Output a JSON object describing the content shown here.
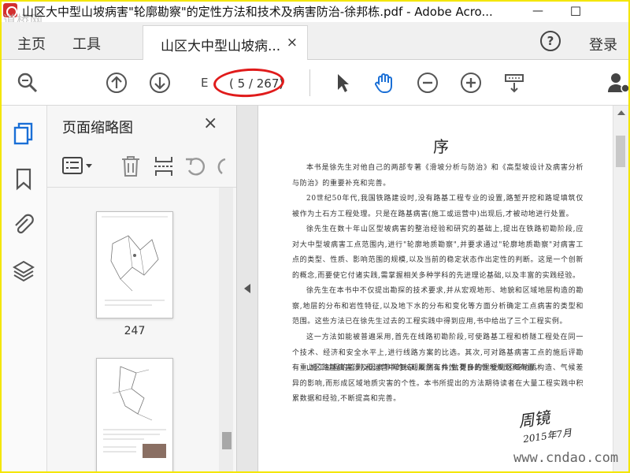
{
  "window": {
    "title": "山区大中型山坡病害\"轮廓勘察\"的定性方法和技术及病害防治-徐邦栋.pdf - Adobe Acro...",
    "minimize_glyph": "—",
    "maximize_glyph": "☐",
    "watermark": "道桥网"
  },
  "tabs": {
    "home": "主页",
    "tools": "工具",
    "document": "山区大中型山坡病...",
    "close_glyph": "×",
    "help_glyph": "?",
    "login": "登录"
  },
  "toolbar": {
    "page_input_value": "E",
    "page_indicator": "( 5 / 267)",
    "icons": [
      "zoom-icon",
      "prev-page-icon",
      "next-page-icon",
      "select-cursor-icon",
      "hand-tool-icon",
      "zoom-out-icon",
      "zoom-in-icon",
      "fit-page-icon",
      "share-user-icon"
    ]
  },
  "left_rail": {
    "icons": [
      "page-thumbnails-icon",
      "bookmark-icon",
      "attachment-icon",
      "layers-icon"
    ]
  },
  "thumbnail_panel": {
    "title": "页面缩略图",
    "close_glyph": "×",
    "tools": [
      "thumbnail-options-icon",
      "delete-page-icon",
      "insert-page-icon",
      "undo-icon"
    ],
    "pages": [
      {
        "label": "247"
      },
      {
        "label": ""
      }
    ]
  },
  "page": {
    "heading": "序",
    "paragraphs": [
      "本书是徐先生对他自己的两部专著《滑坡分析与防治》和《高型坡设计及病害分析与防治》的重要补充和完善。",
      "20世纪50年代,我国铁路建设时,没有路基工程专业的设置,路堑开挖和路堤填筑仅被作为土石方工程处理。只是在路基病害(施工或运营中)出现后,才被动地进行处置。",
      "徐先生在数十年山区型坡病害的整治经验和研究的基础上,提出在铁路初勘阶段,应对大中型坡病害工点范围内,进行\"轮廓地质勘察\",并要求通过\"轮廓地质勘察\"对病害工点的类型、性质、影响范围的规模,以及当前的稳定状态作出定性的判断。这是一个创新的概念,而要使它付诸实践,需掌握相关多种学科的先进理论基础,以及丰富的实践经验。",
      "徐先生在本书中不仅提出勘探的技术要求,并从宏观地形、地貌和区域地层构造的勘察,地层的分布和岩性特征,以及地下水的分布和变化等方面分析确定工点病害的类型和范围。这些方法已在徐先生过去的工程实践中得到应用,书中给出了三个工程实例。",
      "这一方法如能被普遍采用,首先在线路初勘阶段,可使路基工程和桥隧工程处在同一个技术、经济和安全水平上,进行线路方案的比选。其次,可对路基病害工点的施后评勘有重,施工过程的监测,和运营中的长期观测工作,做有目的性地规划和布置。",
      "山区路基病害涉及因素非常复杂,虽然有共性,更多的是受到区域地质构造、气候差异的影响,而形成区域地质灾害的个性。本书所提出的方法期待读者在大量工程实践中积累数据和经验,不断提高和完善。"
    ],
    "signature_name": "周镜",
    "signature_date": "2015年7月"
  },
  "site_watermark": "www.cndao.com"
}
